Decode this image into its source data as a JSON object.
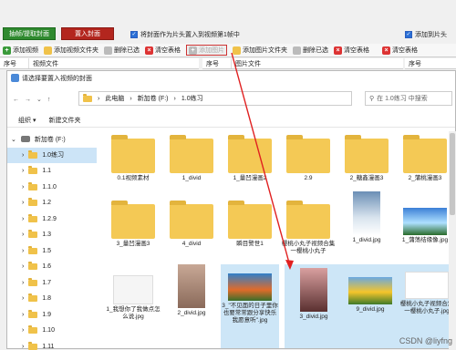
{
  "top": {
    "extract_cover_btn": "抽帧/提取封面",
    "insert_cover_btn": "置入封面",
    "checkbox_label": "将封面作为片头置入到视频第1帧中",
    "right_checkbox_label": "添加到片头"
  },
  "toolbar": {
    "add_video": "添加视频",
    "add_video_folder": "添加视频文件夹",
    "delete_selected": "删除已选",
    "clear_table": "清空表格",
    "add_image": "添加图片",
    "add_image_folder": "添加图片文件夹",
    "delete_selected_2": "删除已选",
    "clear_table_2": "清空表格",
    "clear_table_3": "清空表格"
  },
  "left_header": {
    "col_no": "序号",
    "col_file": "视频文件"
  },
  "right_header": {
    "col_no": "序号",
    "col_file": "图片文件"
  },
  "dialog": {
    "title": "请选择要置入视频的封面",
    "breadcrumb": [
      "此电脑",
      "新加卷 (F:)",
      "1.0练习"
    ],
    "search_placeholder": "在 1.0练习 中搜索",
    "organize": "组织 ▾",
    "new_folder": "新建文件夹"
  },
  "nav": {
    "drive": "新加卷 (F:)",
    "items": [
      "1.0练习",
      "1.1",
      "1.1.0",
      "1.2",
      "1.2.9",
      "1.3",
      "1.5",
      "1.6",
      "1.7",
      "1.8",
      "1.9",
      "1.10",
      "1.11"
    ]
  },
  "files": {
    "row1": [
      "0.1视频素材",
      "1_divid",
      "1_量凹漫画2",
      "2.9",
      "2_糖鑫漫画3",
      "2_蒲桃漫画3"
    ],
    "row2": [
      "3_量凹漫画3",
      "4_divid",
      "瞬目警世1",
      "樱桃小丸子视频合集一樱桃小丸子",
      "1_divid.jpg",
      "1_蒲荡结缘像.jpg"
    ],
    "row3": [
      "1_我想你了我做点怎么说.jpg",
      "2_divid.jpg",
      "3_\"不见面的日子里你也要常常跟分享快乐我愿意听\".jpg",
      "3_divid.jpg",
      "9_divid.jpg",
      "樱桃小丸子视频合集一樱桃小丸子.jpg"
    ]
  },
  "watermark": "CSDN @liyfng"
}
